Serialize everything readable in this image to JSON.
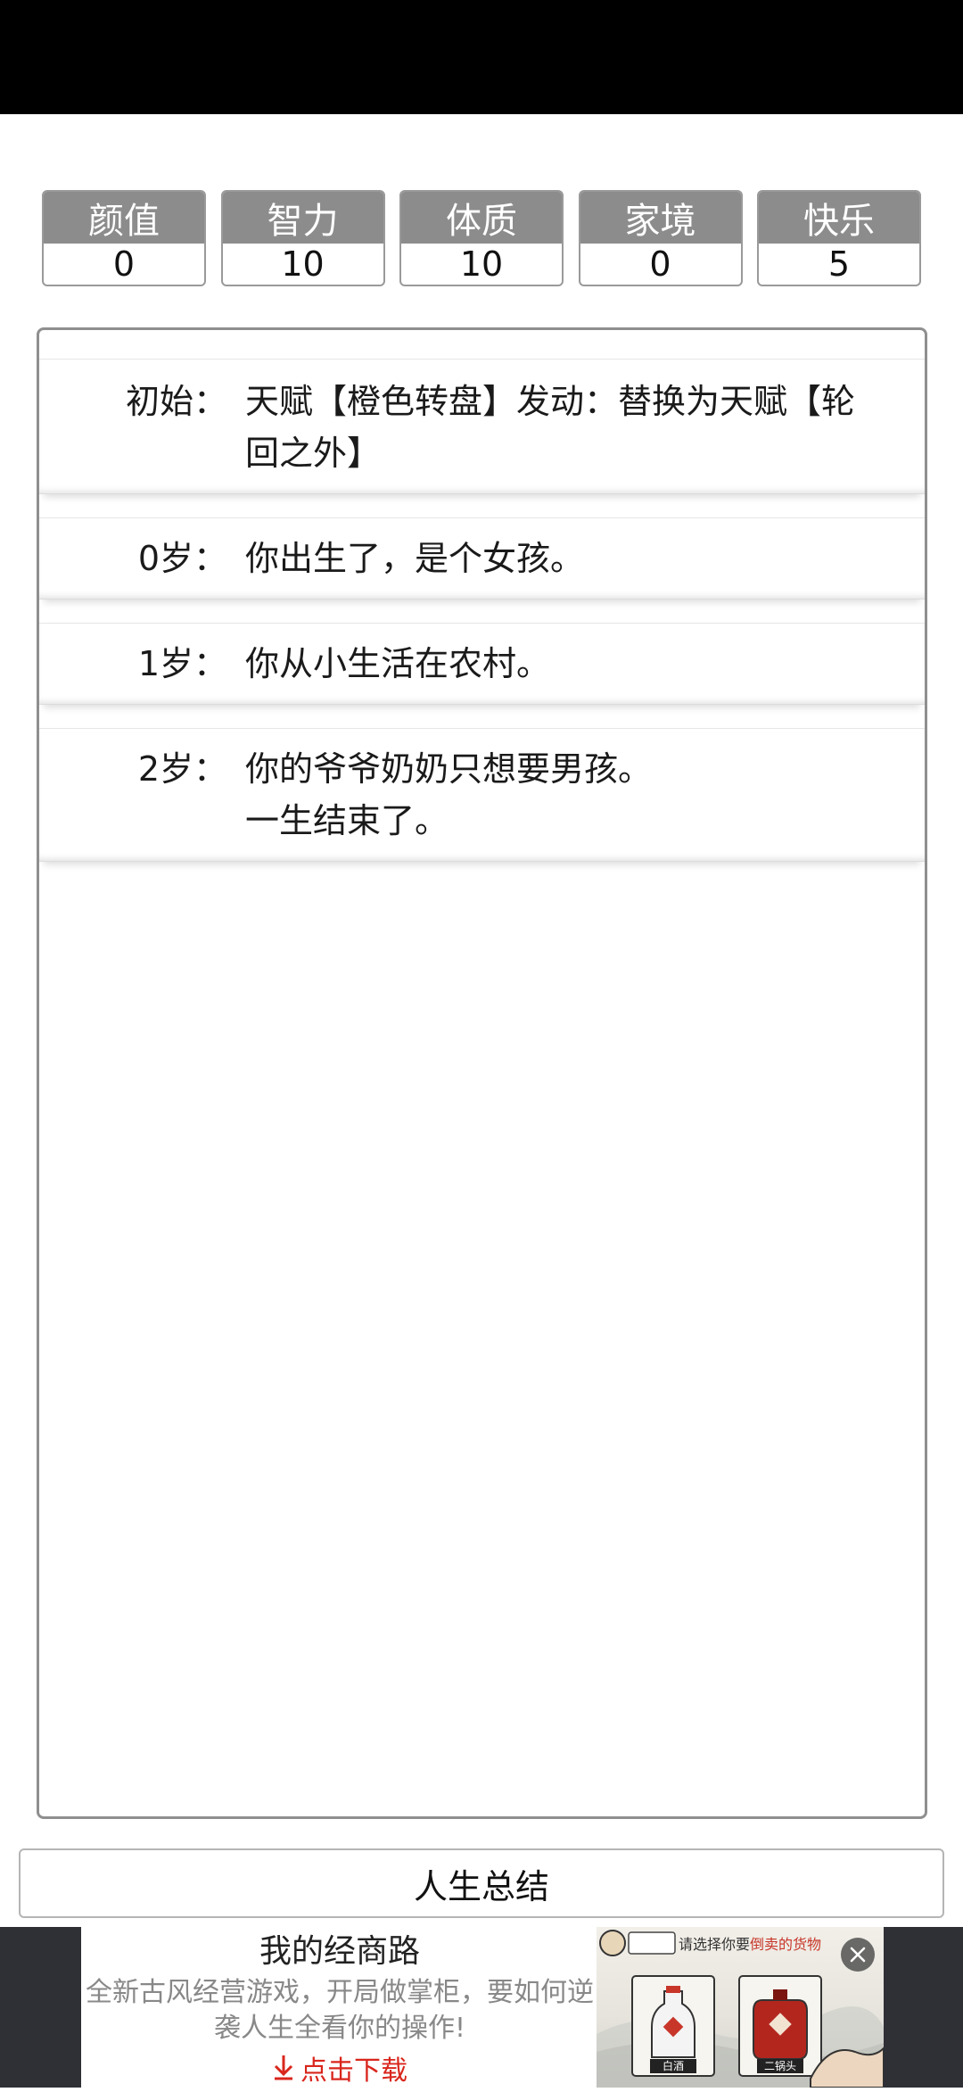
{
  "stats": [
    {
      "label": "颜值",
      "value": "0"
    },
    {
      "label": "智力",
      "value": "10"
    },
    {
      "label": "体质",
      "value": "10"
    },
    {
      "label": "家境",
      "value": "0"
    },
    {
      "label": "快乐",
      "value": "5"
    }
  ],
  "log": [
    {
      "age": "初始：",
      "lines": [
        "天赋【橙色转盘】发动：替换为天赋【轮",
        "回之外】"
      ]
    },
    {
      "age": "0岁：",
      "lines": [
        "你出生了，是个女孩。"
      ]
    },
    {
      "age": "1岁：",
      "lines": [
        "你从小生活在农村。"
      ]
    },
    {
      "age": "2岁：",
      "lines": [
        "你的爷爷奶奶只想要男孩。",
        "一生结束了。"
      ]
    }
  ],
  "summary_button": "人生总结",
  "ad": {
    "title": "我的经商路",
    "desc_lines": [
      "全新古风经营游戏，开局做掌柜，要如何逆",
      "袭人生全看你的操作!"
    ],
    "cta": "点击下载",
    "image_caption_prefix": "请选择你要",
    "image_caption_highlight": "倒卖的货物",
    "item_left": "白酒",
    "item_right": "二锅头"
  }
}
